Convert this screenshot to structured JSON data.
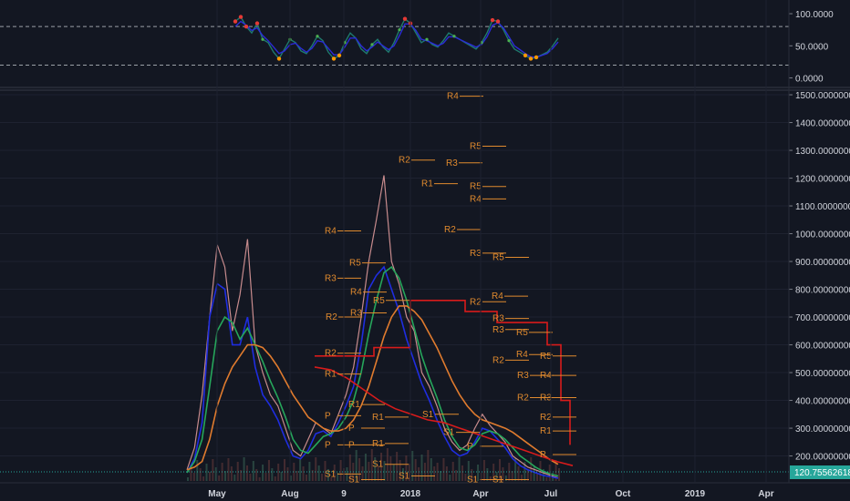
{
  "chart_data": [
    {
      "type": "line",
      "panel": "oscillator",
      "ylim": [
        -12,
        110
      ],
      "y_ticks": [
        "100.0000",
        "50.0000",
        "0.0000"
      ],
      "y_tick_values": [
        100,
        50,
        0
      ],
      "levels": [
        80,
        20
      ],
      "grid": true,
      "colors": {
        "main": "#1e7a6e",
        "signal": "#2b2bd6",
        "marker_red": "#e53935",
        "marker_green": "#4caf50",
        "marker_orange": "#ff9800",
        "level": "#9aa0a6"
      },
      "series": [
        {
          "values": [
            88,
            95,
            80,
            70,
            85,
            60,
            55,
            40,
            30,
            45,
            60,
            55,
            42,
            38,
            50,
            65,
            58,
            40,
            30,
            35,
            55,
            70,
            62,
            45,
            38,
            52,
            60,
            48,
            40,
            55,
            75,
            92,
            85,
            70,
            55,
            60,
            52,
            48,
            58,
            70,
            65,
            60,
            55,
            50,
            45,
            55,
            70,
            90,
            88,
            75,
            58,
            45,
            40,
            35,
            30,
            32,
            36,
            40,
            50,
            62
          ]
        },
        {
          "values": [
            80,
            88,
            82,
            74,
            78,
            66,
            58,
            48,
            38,
            42,
            52,
            54,
            46,
            40,
            46,
            58,
            56,
            46,
            36,
            36,
            48,
            62,
            62,
            50,
            42,
            48,
            56,
            50,
            44,
            50,
            66,
            84,
            84,
            74,
            60,
            58,
            54,
            50,
            54,
            64,
            64,
            60,
            56,
            52,
            48,
            52,
            64,
            82,
            86,
            78,
            64,
            50,
            44,
            38,
            33,
            32,
            35,
            38,
            46,
            56
          ]
        }
      ]
    },
    {
      "type": "line",
      "panel": "price",
      "ylim": [
        110,
        1510
      ],
      "y_ticks": [
        "1500.00000000",
        "1400.00000000",
        "1300.00000000",
        "1200.00000000",
        "1100.00000000",
        "1000.00000000",
        "900.00000000",
        "800.00000000",
        "700.00000000",
        "600.00000000",
        "500.00000000",
        "400.00000000",
        "300.00000000",
        "200.00000000"
      ],
      "y_tick_values": [
        1500,
        1400,
        1300,
        1200,
        1100,
        1000,
        900,
        800,
        700,
        600,
        500,
        400,
        300,
        200
      ],
      "x_ticks": [
        "May",
        "Aug",
        "9",
        "2018",
        "Apr",
        "Jul",
        "Oct",
        "2019",
        "Apr"
      ],
      "grid": true,
      "last_price_label": "120.75562618",
      "colors": {
        "price": "#e8a0a0",
        "ma_blue": "#1f2de0",
        "ma_green": "#26a65b",
        "ma_orange": "#e07b2e",
        "ma_red": "#d81b1b",
        "pivot": "#e08a2e",
        "last_price_tag": "#26a69a"
      },
      "pivot_labels": [
        {
          "label": "R4",
          "value": 1495
        },
        {
          "label": "R5",
          "value": 1315
        },
        {
          "label": "R2",
          "value": 1265
        },
        {
          "label": "R3",
          "value": 1255
        },
        {
          "label": "R1",
          "value": 1180
        },
        {
          "label": "R5",
          "value": 1170
        },
        {
          "label": "R4",
          "value": 1125
        },
        {
          "label": "R4",
          "value": 1010
        },
        {
          "label": "R2",
          "value": 1015
        },
        {
          "label": "R3",
          "value": 930
        },
        {
          "label": "R5",
          "value": 915
        },
        {
          "label": "R5",
          "value": 895
        },
        {
          "label": "R3",
          "value": 840
        },
        {
          "label": "R4",
          "value": 790
        },
        {
          "label": "R4",
          "value": 775
        },
        {
          "label": "R5",
          "value": 760
        },
        {
          "label": "R2",
          "value": 755
        },
        {
          "label": "R3",
          "value": 715
        },
        {
          "label": "R2",
          "value": 700
        },
        {
          "label": "R3",
          "value": 695
        },
        {
          "label": "R3",
          "value": 655
        },
        {
          "label": "R5",
          "value": 645
        },
        {
          "label": "R4",
          "value": 565
        },
        {
          "label": "R5",
          "value": 560
        },
        {
          "label": "R2",
          "value": 545
        },
        {
          "label": "R2",
          "value": 570
        },
        {
          "label": "R3",
          "value": 490
        },
        {
          "label": "R4",
          "value": 490
        },
        {
          "label": "R1",
          "value": 495
        },
        {
          "label": "R2",
          "value": 410
        },
        {
          "label": "R3",
          "value": 410
        },
        {
          "label": "R1",
          "value": 385
        },
        {
          "label": "R2",
          "value": 340
        },
        {
          "label": "P",
          "value": 345
        },
        {
          "label": "S1",
          "value": 350
        },
        {
          "label": "R1",
          "value": 340
        },
        {
          "label": "R1",
          "value": 290
        },
        {
          "label": "P",
          "value": 300
        },
        {
          "label": "S1",
          "value": 285
        },
        {
          "label": "P",
          "value": 240
        },
        {
          "label": "R1",
          "value": 245
        },
        {
          "label": "P",
          "value": 240
        },
        {
          "label": "P",
          "value": 235
        },
        {
          "label": "P",
          "value": 205
        },
        {
          "label": "S1",
          "value": 170
        },
        {
          "label": "S1",
          "value": 135
        },
        {
          "label": "S1",
          "value": 128
        },
        {
          "label": "S1",
          "value": 115
        },
        {
          "label": "S1",
          "value": 115
        },
        {
          "label": "S1",
          "value": 115
        }
      ],
      "series": [
        {
          "values": [
            150,
            230,
            420,
            700,
            960,
            880,
            650,
            780,
            980,
            600,
            500,
            420,
            380,
            300,
            220,
            200,
            260,
            320,
            300,
            280,
            350,
            420,
            520,
            700,
            900,
            1050,
            1210,
            900,
            820,
            700,
            650,
            500,
            450,
            380,
            300,
            250,
            220,
            240,
            300,
            350,
            310,
            280,
            250,
            200,
            180,
            160,
            150,
            140,
            130,
            121
          ]
        },
        {
          "values": [
            140,
            190,
            320,
            700,
            820,
            800,
            600,
            600,
            700,
            520,
            420,
            380,
            330,
            260,
            200,
            190,
            220,
            280,
            290,
            270,
            320,
            380,
            450,
            600,
            800,
            850,
            880,
            800,
            720,
            620,
            540,
            460,
            400,
            330,
            270,
            220,
            200,
            210,
            250,
            300,
            290,
            260,
            230,
            190,
            165,
            150,
            140,
            130,
            125,
            120
          ]
        },
        {
          "values": [
            140,
            180,
            260,
            450,
            650,
            700,
            680,
            620,
            660,
            600,
            540,
            470,
            410,
            340,
            260,
            220,
            210,
            240,
            270,
            280,
            300,
            340,
            400,
            500,
            640,
            760,
            860,
            880,
            840,
            760,
            660,
            560,
            480,
            410,
            330,
            270,
            230,
            220,
            240,
            280,
            290,
            280,
            260,
            230,
            200,
            180,
            160,
            145,
            135,
            128
          ]
        },
        {
          "values": [
            150,
            160,
            180,
            260,
            380,
            460,
            520,
            560,
            600,
            600,
            590,
            560,
            520,
            470,
            420,
            380,
            340,
            320,
            300,
            290,
            290,
            300,
            330,
            380,
            450,
            540,
            630,
            700,
            740,
            740,
            720,
            690,
            640,
            590,
            530,
            470,
            420,
            380,
            350,
            330,
            320,
            310,
            300,
            285,
            265,
            245,
            225,
            205,
            185,
            170
          ]
        }
      ]
    }
  ]
}
